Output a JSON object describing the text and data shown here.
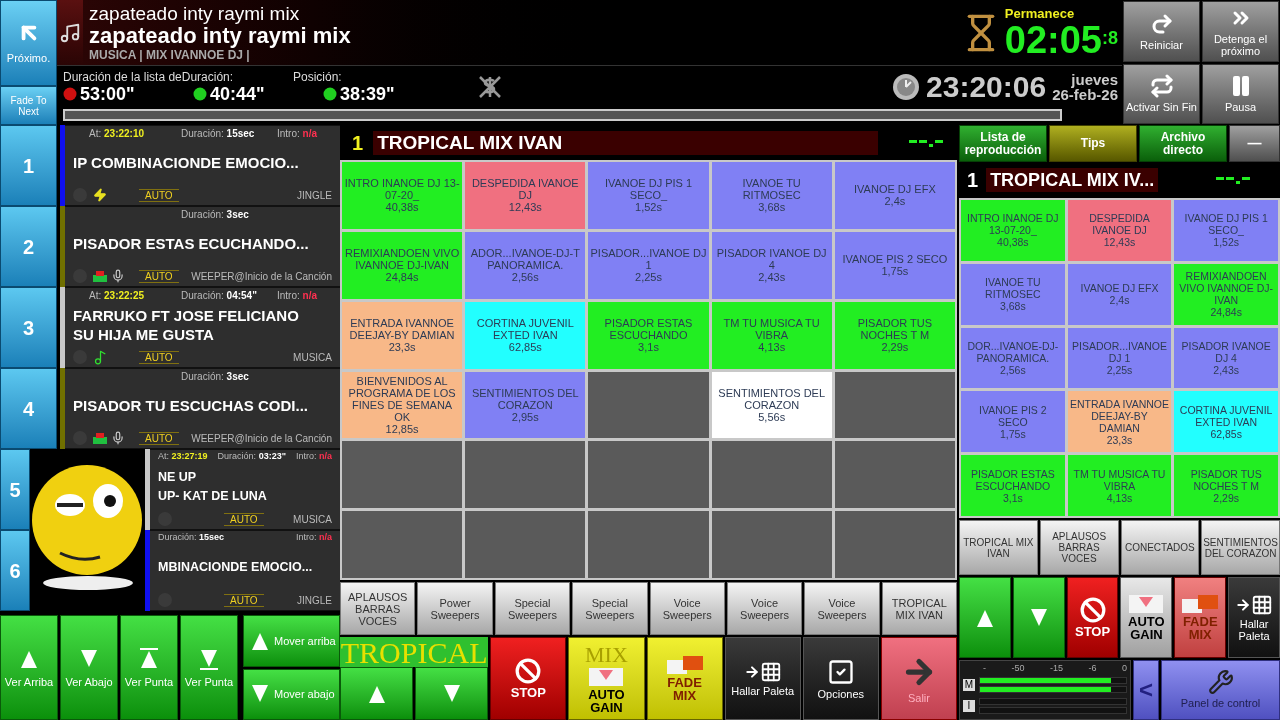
{
  "next_button": {
    "label": "Próximo."
  },
  "fade_button": {
    "label": "Fade To Next"
  },
  "now_playing": {
    "title": "zapateado inty raymi mix",
    "title_bold": "zapateado inty raymi mix",
    "info": "MUSICA | MIX IVANNOE DJ |"
  },
  "remaining": {
    "label": "Permanece",
    "time": "02:05",
    "tenths": ":8"
  },
  "durations": {
    "label": "Duración de la lista deDuración:",
    "position_label": "Posición:",
    "items": [
      {
        "value": "53:00\"",
        "color": "#d01010"
      },
      {
        "value": "40:44\"",
        "color": "#20d020"
      },
      {
        "value": "38:39\"",
        "color": "#20d020"
      }
    ]
  },
  "clock": {
    "time": "23:20:06",
    "day": "jueves",
    "date": "26-feb-26"
  },
  "top_buttons": [
    {
      "kind": "restart",
      "label": "Reiniciar"
    },
    {
      "kind": "stopnext",
      "label": "Detenga el próximo"
    },
    {
      "kind": "loop",
      "label": "Activar Sin Fin"
    },
    {
      "kind": "pause",
      "label": "Pausa"
    }
  ],
  "playlist": [
    {
      "number": "1",
      "color": "#1010f0",
      "fields": [
        {
          "kind": "at",
          "label": "At:",
          "value": "23:22:10"
        },
        {
          "kind": "duration",
          "label": "Duración:",
          "value": "15sec"
        },
        {
          "kind": "intro",
          "label": "Intro:",
          "value": "n/a"
        }
      ],
      "title": [
        "IP COMBINACIONDE EMOCIO..."
      ],
      "kind": "bolt",
      "auto": "AUTO",
      "tag": "JINGLE"
    },
    {
      "number": "2",
      "color": "#707000",
      "fields": [
        {
          "kind": "duration",
          "label": "Duración:",
          "value": "3sec"
        }
      ],
      "title": [
        "PISADOR ESTAS ECUCHANDO..."
      ],
      "kind": "cart-mic",
      "auto": "AUTO",
      "tag": "WEEPER@Inicio de la Canción"
    },
    {
      "number": "3",
      "color": "#c8c8c8",
      "fields": [
        {
          "kind": "at",
          "label": "At:",
          "value": "23:22:25"
        },
        {
          "kind": "duration",
          "label": "Duración:",
          "value": "04:54\""
        },
        {
          "kind": "intro",
          "label": "Intro:",
          "value": "n/a"
        }
      ],
      "title": [
        "FARRUKO FT JOSE FELICIANO",
        "SU HIJA ME GUSTA"
      ],
      "kind": "music",
      "auto": "AUTO",
      "tag": "MUSICA"
    },
    {
      "number": "4",
      "color": "#707000",
      "fields": [
        {
          "kind": "duration",
          "label": "Duración:",
          "value": "3sec"
        }
      ],
      "title": [
        "PISADOR TU ESCUCHAS CODI..."
      ],
      "kind": "cart-mic",
      "auto": "AUTO",
      "tag": "WEEPER@Inicio de la Canción"
    },
    {
      "number": "5",
      "color": "#c8c8c8",
      "fields": [
        {
          "kind": "at",
          "label": "At:",
          "value": "23:27:19"
        },
        {
          "kind": "duration",
          "label": "Duración:",
          "value": "03:23\""
        },
        {
          "kind": "intro",
          "label": "Intro:",
          "value": "n/a"
        }
      ],
      "title": [
        "NE UP",
        "UP- KAT DE LUNA"
      ],
      "auto": "AUTO",
      "tag": "MUSICA"
    },
    {
      "number": "6",
      "color": "#1010f0",
      "fields": [
        {
          "kind": "duration",
          "label": "Duración:",
          "value": "15sec"
        },
        {
          "kind": "intro",
          "label": "Intro:",
          "value": "n/a"
        }
      ],
      "title": [
        "MBINACIONDE EMOCIO..."
      ],
      "auto": "AUTO",
      "tag": "JINGLE"
    }
  ],
  "list_buttons": [
    {
      "kind": "up",
      "label": "Ver Arriba"
    },
    {
      "kind": "down",
      "label": "Ver Abajo"
    },
    {
      "kind": "top",
      "label": "Ver Punta"
    },
    {
      "kind": "bottom",
      "label": "Ver Punta"
    }
  ],
  "move_buttons": [
    {
      "kind": "up",
      "label": "Mover arriba"
    },
    {
      "kind": "down",
      "label": "Mover abajo"
    }
  ],
  "palette": {
    "number": "1",
    "title": "TROPICAL MIX IVAN",
    "cells": [
      {
        "label": "INTRO INANOE DJ 13-07-20_",
        "duration": "40,38s",
        "color": "#22ee22"
      },
      {
        "label": "DESPEDIDA IVANOE DJ",
        "duration": "12,43s",
        "color": "#f07080"
      },
      {
        "label": "IVANOE DJ PIS 1 SECO_",
        "duration": "1,52s",
        "color": "#8080f4"
      },
      {
        "label": "IVANOE TU RITMOSEC",
        "duration": "3,68s",
        "color": "#8080f4"
      },
      {
        "label": "IVANOE DJ EFX",
        "duration": "2,4s",
        "color": "#8080f4"
      },
      {
        "label": "REMIXIANDOEN VIVO IVANNOE DJ-IVAN",
        "duration": "24,84s",
        "color": "#22ee22"
      },
      {
        "label": "ADOR...IVANOE-DJ-T PANORAMICA.",
        "duration": "2,56s",
        "color": "#8080f4"
      },
      {
        "label": "PISADOR...IVANOE DJ  1",
        "duration": "2,25s",
        "color": "#8080f4"
      },
      {
        "label": "PISADOR IVANOE DJ 4",
        "duration": "2,43s",
        "color": "#8080f4"
      },
      {
        "label": "IVANOE PIS 2 SECO",
        "duration": "1,75s",
        "color": "#8080f4"
      },
      {
        "label": "ENTRADA IVANNOE DEEJAY-BY DAMIAN",
        "duration": "23,3s",
        "color": "#f8b888"
      },
      {
        "label": "CORTINA JUVENIL EXTED IVAN",
        "duration": "62,85s",
        "color": "#22ffff"
      },
      {
        "label": "PISADOR ESTAS ESCUCHANDO",
        "duration": "3,1s",
        "color": "#22ee22"
      },
      {
        "label": "TM TU MUSICA TU VIBRA",
        "duration": "4,13s",
        "color": "#22ee22"
      },
      {
        "label": "PISADOR TUS NOCHES T M",
        "duration": "2,29s",
        "color": "#22ee22"
      },
      {
        "label": "BIENVENIDOS AL PROGRAMA DE LOS FINES DE SEMANA OK",
        "duration": "12,85s",
        "color": "#f8b888"
      },
      {
        "label": "SENTIMIENTOS DEL CORAZON",
        "duration": "2,95s",
        "color": "#8080f4"
      },
      {
        "kind": "empty"
      },
      {
        "label": "SENTIMIENTOS DEL CORAZON",
        "duration": "5,56s",
        "color": "#ffffff"
      },
      {
        "kind": "empty"
      },
      {
        "kind": "empty"
      },
      {
        "kind": "empty"
      },
      {
        "kind": "empty"
      },
      {
        "kind": "empty"
      },
      {
        "kind": "empty"
      },
      {
        "kind": "empty"
      },
      {
        "kind": "empty"
      },
      {
        "kind": "empty"
      },
      {
        "kind": "empty"
      },
      {
        "kind": "empty"
      }
    ]
  },
  "sweepers": [
    "APLAUSOS BARRAS VOCES",
    "Power Sweepers",
    "Special Sweepers",
    "Special Sweepers",
    "Voice Sweepers",
    "Voice Sweepers",
    "Voice Sweepers",
    "TROPICAL MIX IVAN"
  ],
  "controls": [
    {
      "kind": "up"
    },
    {
      "kind": "down"
    },
    {
      "kind": "stop",
      "label": "STOP"
    },
    {
      "kind": "autogain",
      "label": "AUTO GAIN"
    },
    {
      "kind": "fademix",
      "label": "FADE MIX"
    },
    {
      "kind": "palette",
      "label": "Hallar Paleta"
    },
    {
      "kind": "options",
      "label": "Opciones"
    },
    {
      "kind": "exit",
      "label": "Salir"
    }
  ],
  "overlay_caption": [
    "TROPICAL",
    "MIX"
  ],
  "side_tabs": [
    {
      "label": "Lista de reproducción",
      "selected": false
    },
    {
      "label": "Tips",
      "selected": true
    },
    {
      "label": "Archivo directo",
      "selected": false
    }
  ],
  "minimize": {
    "label": "—"
  },
  "side_palette": {
    "number": "1",
    "title": "TROPICAL MIX IV...",
    "cells": [
      {
        "label": "INTRO INANOE DJ 13-07-20_",
        "duration": "40,38s",
        "color": "#22ee22"
      },
      {
        "label": "DESPEDIDA IVANOE DJ",
        "duration": "12,43s",
        "color": "#f07080"
      },
      {
        "label": "IVANOE DJ PIS 1 SECO_",
        "duration": "1,52s",
        "color": "#8080f4"
      },
      {
        "label": "IVANOE TU RITMOSEC",
        "duration": "3,68s",
        "color": "#8080f4"
      },
      {
        "label": "IVANOE DJ EFX",
        "duration": "2,4s",
        "color": "#8080f4"
      },
      {
        "label": "REMIXIANDOEN VIVO IVANNOE DJ-IVAN",
        "duration": "24,84s",
        "color": "#22ee22"
      },
      {
        "label": "DOR...IVANOE-DJ-PANORAMICA.",
        "duration": "2,56s",
        "color": "#8080f4"
      },
      {
        "label": "PISADOR...IVANOE DJ  1",
        "duration": "2,25s",
        "color": "#8080f4"
      },
      {
        "label": "PISADOR IVANOE DJ 4",
        "duration": "2,43s",
        "color": "#8080f4"
      },
      {
        "label": "IVANOE PIS 2 SECO",
        "duration": "1,75s",
        "color": "#8080f4"
      },
      {
        "label": "ENTRADA IVANNOE DEEJAY-BY DAMIAN",
        "duration": "23,3s",
        "color": "#f8b888"
      },
      {
        "label": "CORTINA JUVENIL EXTED IVAN",
        "duration": "62,85s",
        "color": "#22ffff"
      },
      {
        "label": "PISADOR ESTAS ESCUCHANDO",
        "duration": "3,1s",
        "color": "#22ee22"
      },
      {
        "label": "TM TU MUSICA TU VIBRA",
        "duration": "4,13s",
        "color": "#22ee22"
      },
      {
        "label": "PISADOR TUS NOCHES T M",
        "duration": "2,29s",
        "color": "#22ee22"
      }
    ]
  },
  "side_pages": [
    "TROPICAL MIX IVAN",
    "APLAUSOS BARRAS VOCES",
    "CONECTADOS",
    "SENTIMIENTOS DEL CORAZON"
  ],
  "side_controls": [
    {
      "kind": "up"
    },
    {
      "kind": "down"
    },
    {
      "kind": "stop",
      "label": "STOP"
    },
    {
      "kind": "autogain",
      "label": "AUTO GAIN"
    },
    {
      "kind": "fademix",
      "label": "FADE MIX"
    },
    {
      "kind": "palette",
      "label": "Hallar Paleta"
    }
  ],
  "meter": {
    "scale": [
      "-",
      "-50",
      "-15",
      "-6",
      "0"
    ],
    "channels": [
      {
        "label": "M",
        "level": 0.9
      },
      {
        "label": "I"
      }
    ]
  },
  "back_button": {
    "label": "<"
  },
  "panel_button": {
    "label": "Panel de control"
  }
}
